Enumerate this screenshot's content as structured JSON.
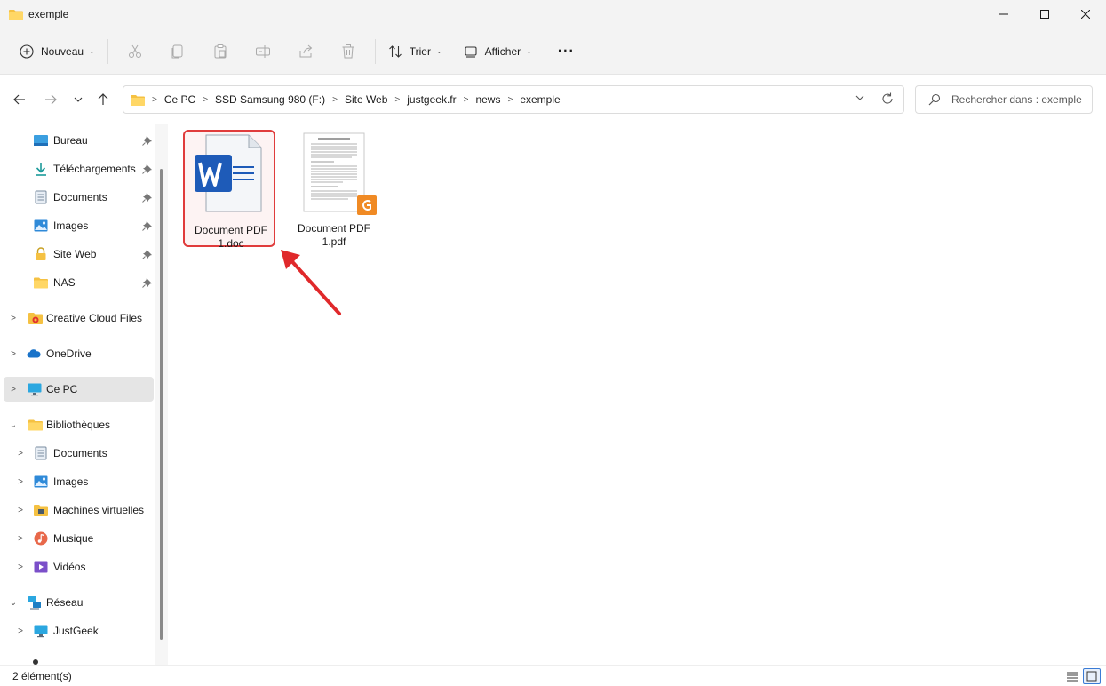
{
  "window": {
    "title": "exemple"
  },
  "toolbar": {
    "new_label": "Nouveau",
    "sort_label": "Trier",
    "view_label": "Afficher",
    "more_label": "···"
  },
  "address": {
    "crumbs": [
      "Ce PC",
      "SSD Samsung 980 (F:)",
      "Site Web",
      "justgeek.fr",
      "news",
      "exemple"
    ]
  },
  "search": {
    "placeholder": "Rechercher dans : exemple"
  },
  "sidebar": {
    "quick_access": [
      "Bureau",
      "Téléchargements",
      "Documents",
      "Images",
      "Site Web",
      "NAS"
    ],
    "roots": {
      "creative_cloud": "Creative Cloud Files",
      "onedrive": "OneDrive",
      "this_pc": "Ce PC",
      "libraries": "Bibliothèques",
      "network": "Réseau"
    },
    "libraries": [
      "Documents",
      "Images",
      "Machines virtuelles",
      "Musique",
      "Vidéos"
    ],
    "network_items": [
      "JustGeek"
    ]
  },
  "files": [
    {
      "name_line1": "Document PDF",
      "name_line2": "1.doc",
      "type": "word"
    },
    {
      "name_line1": "Document PDF",
      "name_line2": "1.pdf",
      "type": "pdf"
    }
  ],
  "status": {
    "count": "2 élément(s)"
  },
  "colors": {
    "highlight": "#e03c3c",
    "word_blue": "#1e5bb8",
    "folder_yellow": "#f5c142",
    "pdf_orange": "#f08a24"
  }
}
